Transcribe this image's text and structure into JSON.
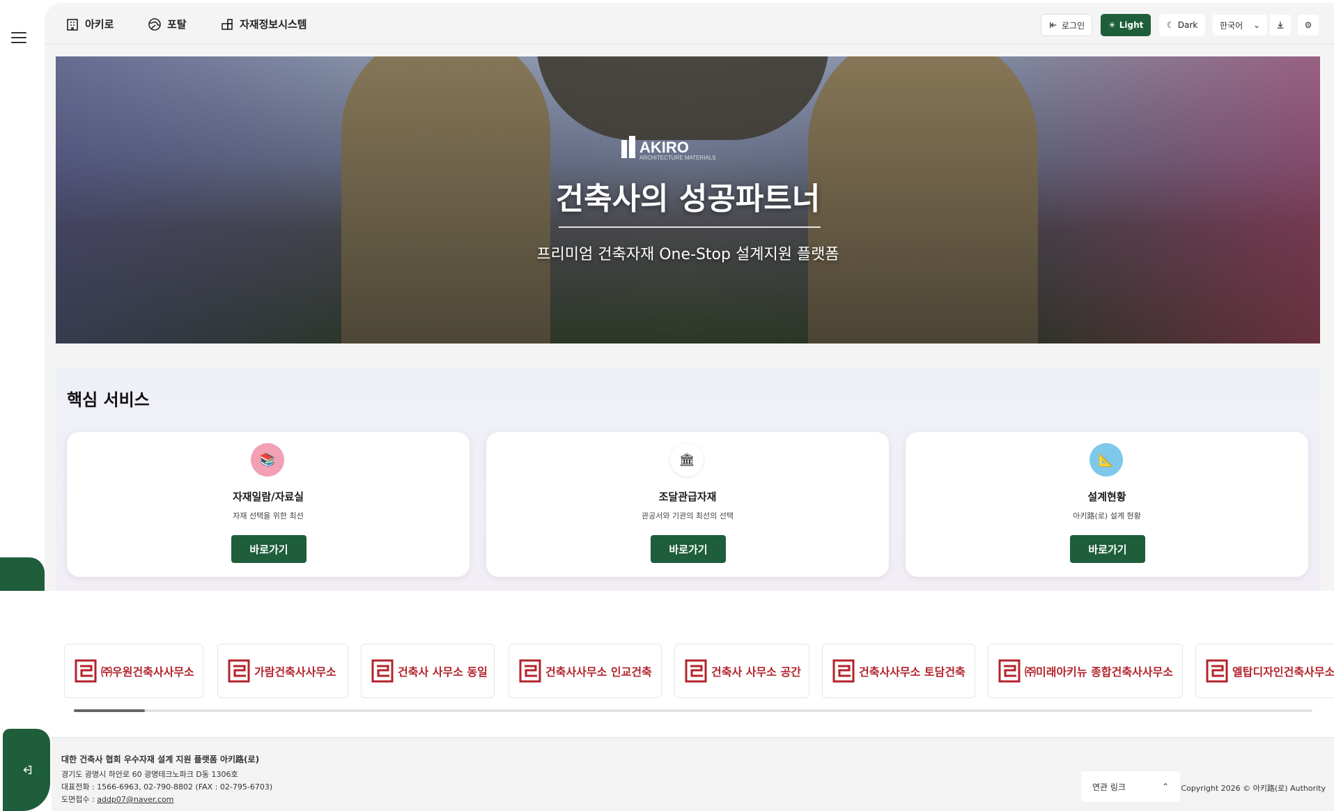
{
  "nav": {
    "items": [
      {
        "label": "아키로",
        "icon": "building-icon"
      },
      {
        "label": "포탈",
        "icon": "globe-icon"
      },
      {
        "label": "자재정보시스템",
        "icon": "grid-icon"
      }
    ]
  },
  "header": {
    "login_label": "로그인",
    "light_label": "Light",
    "dark_label": "Dark",
    "language": "한국어"
  },
  "hero": {
    "logo_text": "AKIRO",
    "logo_sub": "ARCHITECTURE MATERIALS",
    "title": "건축사의 성공파트너",
    "subtitle": "프리미엄 건축자재 One-Stop 설계지원 플랫폼"
  },
  "services": {
    "title": "핵심 서비스",
    "cards": [
      {
        "title": "자재일람/자료실",
        "desc": "자재 선택을 위한 최선",
        "button": "바로가기",
        "icon": "books-icon",
        "icon_bg": "#f2a0b4"
      },
      {
        "title": "조달관급자재",
        "desc": "관공서와 기관의 최선의 선택",
        "button": "바로가기",
        "icon": "government-building-icon",
        "icon_bg": "#ffffff"
      },
      {
        "title": "설계현황",
        "desc": "아키路(로) 설계 현황",
        "button": "바로가기",
        "icon": "drafting-triangle-icon",
        "icon_bg": "#7ec8ec"
      }
    ]
  },
  "partners": [
    "㈜우원건축사사무소",
    "가람건축사사무소",
    "건축사 사무소 동일",
    "건축사사무소 인교건축",
    "건축사 사무소 공간",
    "건축사사무소 토담건축",
    "㈜미래아키뉴 종합건축사사무소",
    "엘탑디자인건축사무소"
  ],
  "footer": {
    "line1": "대한 건축사 협회 우수자재 설계 지원 플랫폼 아키路(로)",
    "line2": "경기도 광명시 하안로 60 광명테크노파크 D동 1306호",
    "line3": "대표전화 : 1566-6963, 02-790-8802 (FAX : 02-795-6703)",
    "line4_prefix": "도면접수 : ",
    "email": "addp07@naver.com",
    "related_links": "연관 링크",
    "copyright": "Copyright 2026 © 아키路(로) Authority"
  },
  "colors": {
    "brand_green": "#1e5e3a",
    "partner_red": "#b3232b"
  }
}
